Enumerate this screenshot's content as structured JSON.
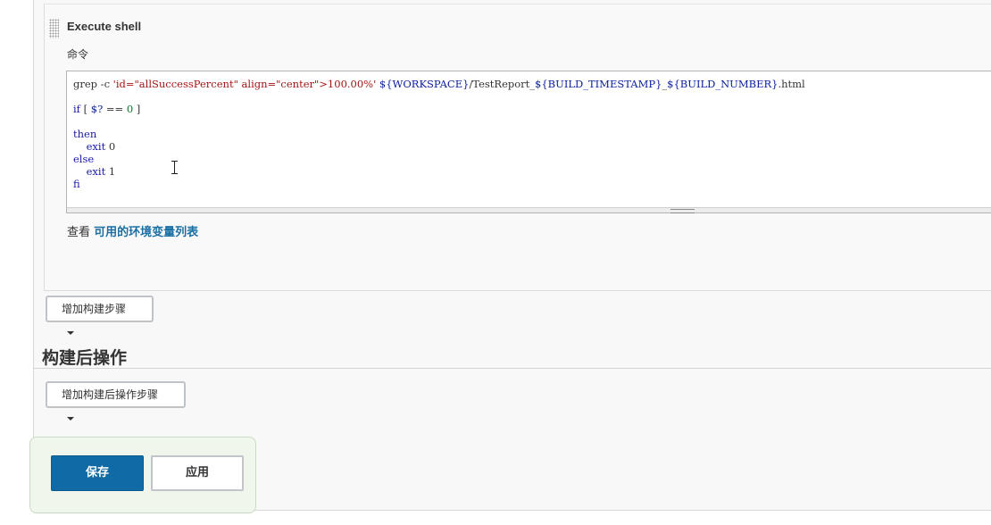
{
  "build_step": {
    "title": "Execute shell",
    "command_label": "命令",
    "command_lines": [
      [
        {
          "t": "grep -c ",
          "c": "plain"
        },
        {
          "t": "'id=\"allSuccessPercent\" align=\"center\">100.00%'",
          "c": "str"
        },
        {
          "t": " ",
          "c": "plain"
        },
        {
          "t": "${WORKSPACE}",
          "c": "var"
        },
        {
          "t": "/TestReport_",
          "c": "plain"
        },
        {
          "t": "${BUILD_TIMESTAMP}",
          "c": "var"
        },
        {
          "t": "_",
          "c": "plain"
        },
        {
          "t": "${BUILD_NUMBER}",
          "c": "var"
        },
        {
          "t": ".html",
          "c": "plain"
        }
      ],
      [],
      [
        {
          "t": "if",
          "c": "kw"
        },
        {
          "t": " [ ",
          "c": "plain"
        },
        {
          "t": "$?",
          "c": "var"
        },
        {
          "t": " == ",
          "c": "plain"
        },
        {
          "t": "0",
          "c": "num"
        },
        {
          "t": " ]",
          "c": "plain"
        }
      ],
      [],
      [
        {
          "t": "then",
          "c": "kw"
        }
      ],
      [
        {
          "t": "    exit ",
          "c": "kw"
        },
        {
          "t": "0",
          "c": "plain"
        }
      ],
      [
        {
          "t": "else",
          "c": "kw"
        }
      ],
      [
        {
          "t": "    exit ",
          "c": "kw"
        },
        {
          "t": "1",
          "c": "plain"
        }
      ],
      [
        {
          "t": "fi",
          "c": "kw"
        }
      ]
    ],
    "env_prefix": "查看 ",
    "env_link": "可用的环境变量列表"
  },
  "add_build_step_label": "增加构建步骤",
  "post_build": {
    "title": "构建后操作",
    "add_label": "增加构建后操作步骤"
  },
  "footer": {
    "save_label": "保存",
    "apply_label": "应用"
  },
  "colors": {
    "primary": "#0f6aa5",
    "link": "#1a6fa3",
    "bottom_bar_bg": "#f0f6ec",
    "bottom_bar_border": "#c7dcbf"
  },
  "icons": [
    "drag-handle-icon",
    "caret-down-icon",
    "text-cursor-icon"
  ]
}
